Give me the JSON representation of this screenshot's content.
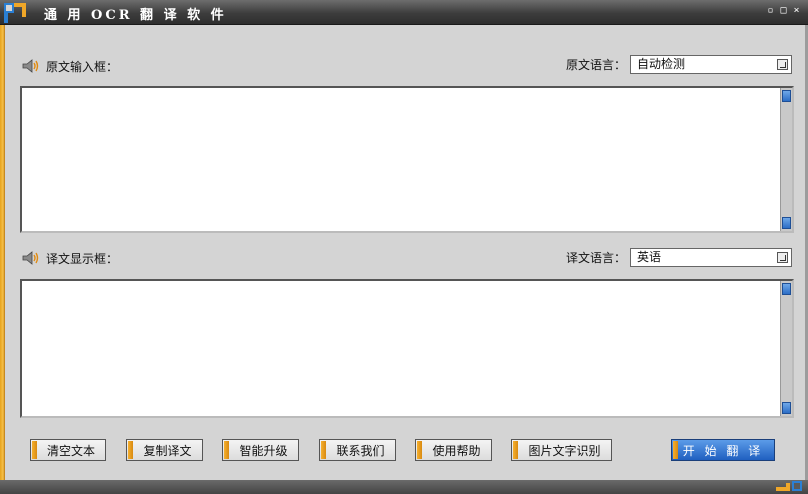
{
  "window": {
    "title": "通 用 OCR 翻 译 软 件",
    "minimize": "▫",
    "maximize": "□",
    "close": "×"
  },
  "source": {
    "label": "原文输入框：",
    "lang_label": "原文语言：",
    "lang_value": "自动检测",
    "text": ""
  },
  "target": {
    "label": "译文显示框：",
    "lang_label": "译文语言：",
    "lang_value": "英语",
    "text": ""
  },
  "buttons": {
    "clear": "清空文本",
    "copy": "复制译文",
    "upgrade": "智能升级",
    "contact": "联系我们",
    "help": "使用帮助",
    "ocr": "图片文字识别",
    "translate": "开 始 翻 译"
  },
  "colors": {
    "accent_orange": "#f0a728",
    "primary_blue": "#2f72d0",
    "titlebar": "#3d3d3d"
  }
}
